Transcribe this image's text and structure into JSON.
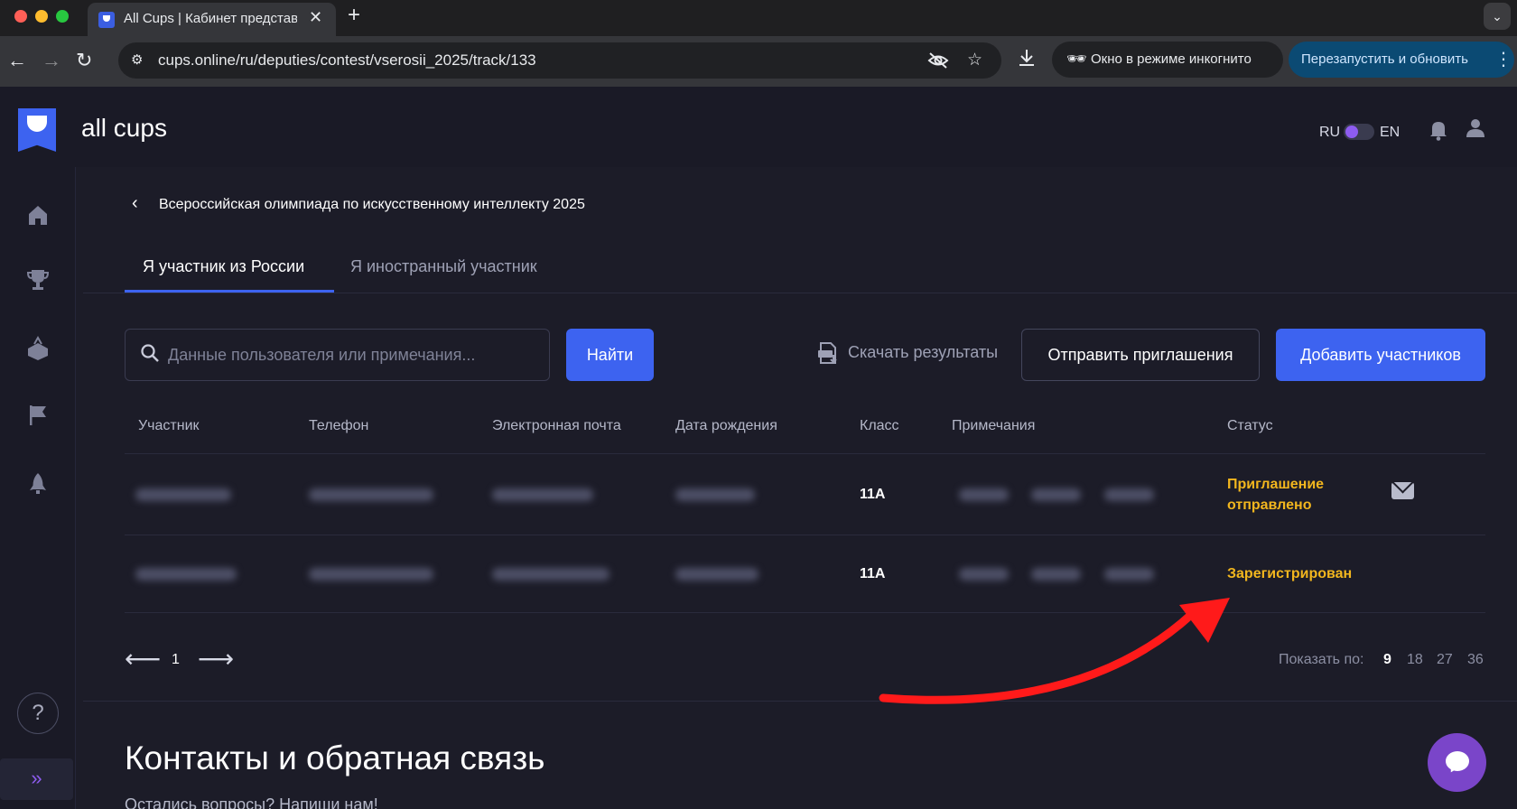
{
  "browser": {
    "tab_title": "All Cups | Кабинет представителя",
    "url": "cups.online/ru/deputies/contest/vserosii_2025/track/133",
    "incognito_label": "Окно в режиме инкогнито",
    "relaunch_label": "Перезапустить и обновить"
  },
  "header": {
    "logo_text": "all cups",
    "lang_ru": "RU",
    "lang_en": "EN"
  },
  "page": {
    "breadcrumb": "Всероссийская олимпиада по искусственному интеллекту 2025",
    "tabs": [
      {
        "label": "Я участник из России",
        "active": true
      },
      {
        "label": "Я иностранный участник",
        "active": false
      }
    ]
  },
  "actions": {
    "search_placeholder": "Данные пользователя или примечания...",
    "find_label": "Найти",
    "download_label": "Скачать результаты",
    "invite_label": "Отправить приглашения",
    "add_label": "Добавить участников"
  },
  "table": {
    "columns": [
      "Участник",
      "Телефон",
      "Электронная почта",
      "Дата рождения",
      "Класс",
      "Примечания",
      "Статус"
    ],
    "rows": [
      {
        "class": "11А",
        "status": "Приглашение отправлено"
      },
      {
        "class": "11А",
        "status": "Зарегистрирован"
      }
    ]
  },
  "pagination": {
    "current_page": "1",
    "show_label": "Показать по:",
    "sizes": [
      "9",
      "18",
      "27",
      "36"
    ],
    "active_size": "9"
  },
  "contacts": {
    "title": "Контакты и обратная связь",
    "subtitle": "Остались вопросы? Напиши нам!"
  },
  "colors": {
    "accent": "#3d63f0",
    "status": "#f2b61e",
    "background": "#1c1c28",
    "annotation_arrow": "#ff1a1a"
  }
}
